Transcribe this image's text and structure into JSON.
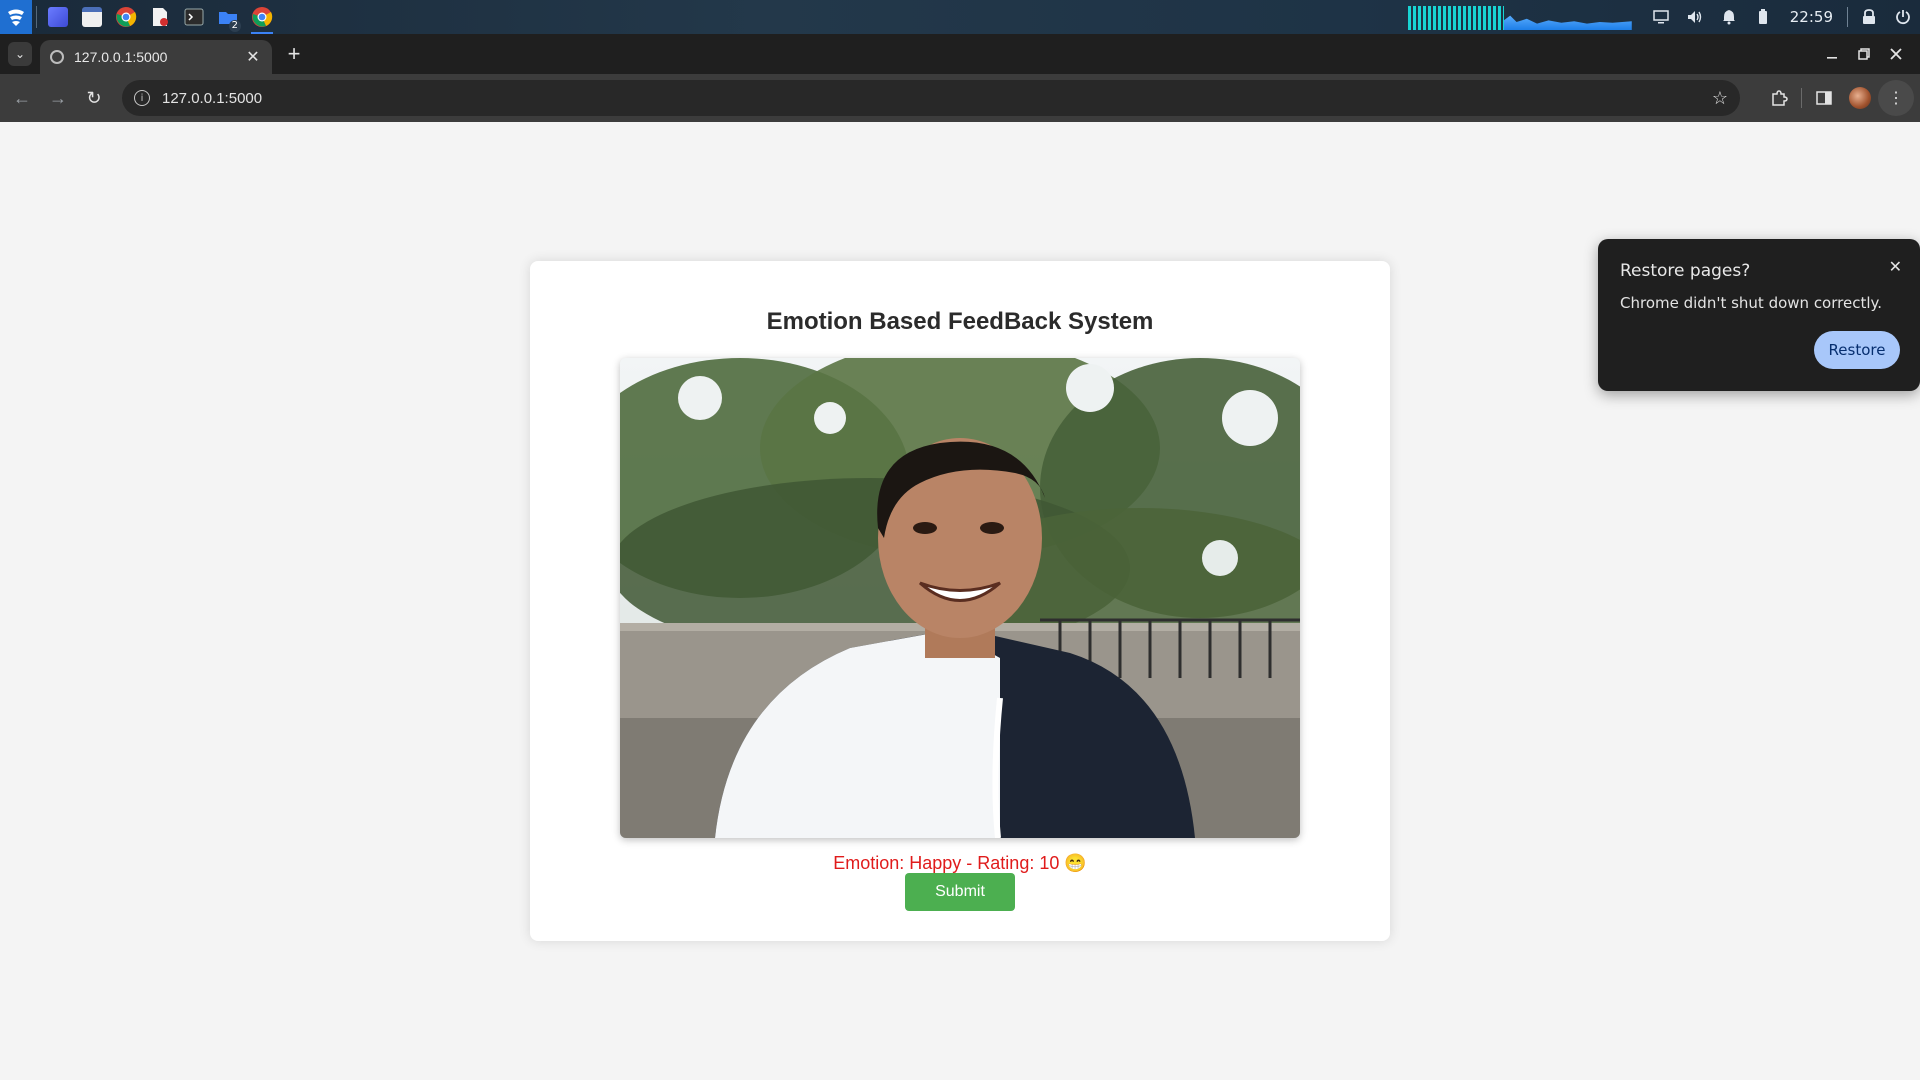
{
  "taskbar": {
    "apps": [
      {
        "name": "launcher-icon",
        "color": "#1f6fd1"
      },
      {
        "name": "desktop-icon",
        "color": "#5b6cf0"
      },
      {
        "name": "file-manager-icon",
        "color": "#e8e8e8"
      },
      {
        "name": "chrome-icon",
        "color": "#db4437"
      },
      {
        "name": "document-viewer-icon",
        "color": "#f2f2f2"
      },
      {
        "name": "terminal-icon",
        "color": "#2b2b2b"
      },
      {
        "name": "folder-group-icon",
        "color": "#3b82f6",
        "badge": "2"
      },
      {
        "name": "chrome-active-icon",
        "color": "#f4b400"
      }
    ],
    "clock": "22:59"
  },
  "browser": {
    "tab_title": "127.0.0.1:5000",
    "url": "127.0.0.1:5000"
  },
  "page": {
    "title": "Emotion Based FeedBack System",
    "emotion_text": "Emotion: Happy - Rating: 10 😁",
    "submit_label": "Submit",
    "colors": {
      "emotion_text": "#e01b1b",
      "submit_bg": "#4caf50"
    }
  },
  "restore_popup": {
    "title": "Restore pages?",
    "message": "Chrome didn't shut down correctly.",
    "button_label": "Restore"
  }
}
